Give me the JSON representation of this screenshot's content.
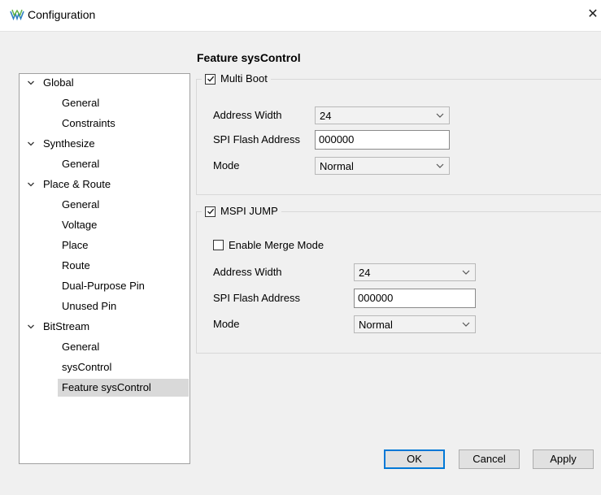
{
  "window": {
    "title": "Configuration",
    "app_icon": "gowin-logo-icon",
    "close_symbol": "✕"
  },
  "tree": {
    "items": [
      {
        "label": "Global",
        "level": 0,
        "expanded": true
      },
      {
        "label": "General",
        "level": 1
      },
      {
        "label": "Constraints",
        "level": 1
      },
      {
        "label": "Synthesize",
        "level": 0,
        "expanded": true
      },
      {
        "label": "General",
        "level": 1
      },
      {
        "label": "Place & Route",
        "level": 0,
        "expanded": true
      },
      {
        "label": "General",
        "level": 1
      },
      {
        "label": "Voltage",
        "level": 1
      },
      {
        "label": "Place",
        "level": 1
      },
      {
        "label": "Route",
        "level": 1
      },
      {
        "label": "Dual-Purpose Pin",
        "level": 1
      },
      {
        "label": "Unused Pin",
        "level": 1
      },
      {
        "label": "BitStream",
        "level": 0,
        "expanded": true
      },
      {
        "label": "General",
        "level": 1
      },
      {
        "label": "sysControl",
        "level": 1
      },
      {
        "label": "Feature sysControl",
        "level": 1,
        "selected": true
      }
    ]
  },
  "panel": {
    "heading": "Feature sysControl",
    "multi_boot": {
      "label": "Multi Boot",
      "checked": true,
      "address_width_label": "Address Width",
      "address_width_value": "24",
      "spi_flash_address_label": "SPI Flash Address",
      "spi_flash_address_value": "000000",
      "mode_label": "Mode",
      "mode_value": "Normal"
    },
    "mspi_jump": {
      "label": "MSPI JUMP",
      "checked": true,
      "enable_merge_label": "Enable Merge Mode",
      "enable_merge_checked": false,
      "address_width_label": "Address Width",
      "address_width_value": "24",
      "spi_flash_address_label": "SPI Flash Address",
      "spi_flash_address_value": "000000",
      "mode_label": "Mode",
      "mode_value": "Normal"
    }
  },
  "buttons": {
    "ok": "OK",
    "cancel": "Cancel",
    "apply": "Apply"
  },
  "colors": {
    "default_button_border": "#0078d7",
    "selected_tree_item": "#d9d9d9",
    "dialog_background": "#f0f0f0"
  }
}
